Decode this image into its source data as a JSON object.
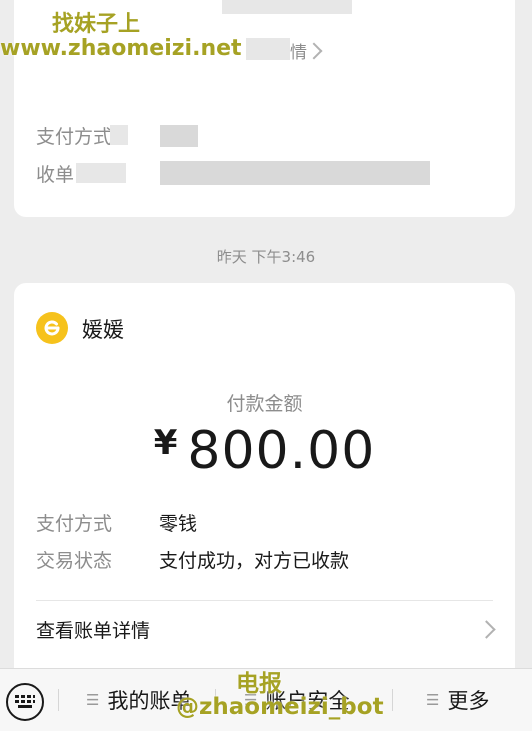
{
  "watermark": {
    "line1": "找妹子上",
    "line2": "www.zhaomeizi.net",
    "telegram_line1": "电报",
    "telegram_line2": "@zhaomeizi_bot"
  },
  "card_top": {
    "detail_suffix": "情",
    "rows": [
      {
        "label": "支付方式"
      },
      {
        "label": "收单"
      }
    ]
  },
  "timestamp": "昨天 下午3:46",
  "card_main": {
    "merchant_name": "媛媛",
    "amount_label": "付款金额",
    "currency_symbol": "¥",
    "amount": "800.00",
    "rows": [
      {
        "label": "支付方式",
        "value": "零钱"
      },
      {
        "label": "交易状态",
        "value": "支付成功，对方已收款"
      }
    ],
    "detail_link": "查看账单详情"
  },
  "bottom_bar": {
    "items": [
      "我的账单",
      "账户安全",
      "更多"
    ]
  },
  "colors": {
    "accent_yellow": "#f6c21c",
    "watermark": "#a6a224",
    "background": "#ededed"
  }
}
